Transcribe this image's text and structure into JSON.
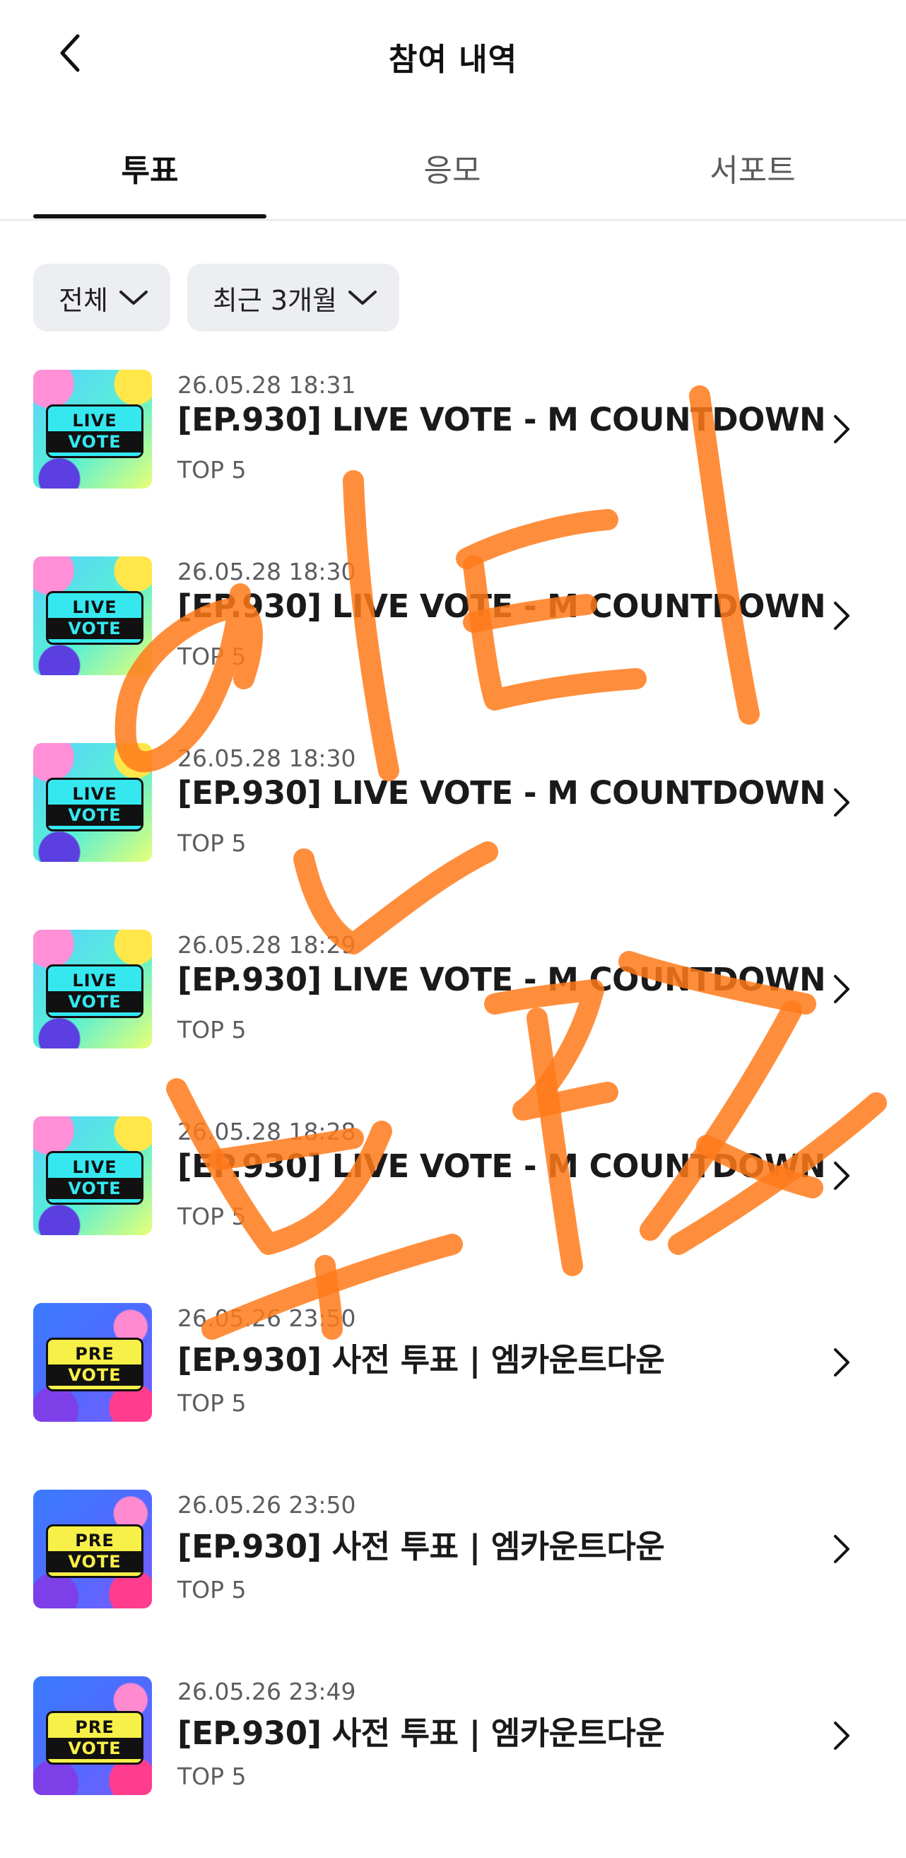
{
  "header": {
    "title": "참여 내역"
  },
  "tabs": [
    {
      "label": "투표",
      "active": true
    },
    {
      "label": "응모",
      "active": false
    },
    {
      "label": "서포트",
      "active": false
    }
  ],
  "filters": [
    {
      "label": "전체"
    },
    {
      "label": "최근 3개월"
    }
  ],
  "items": [
    {
      "date": "26.05.28 18:31",
      "title": "[EP.930] LIVE VOTE - M COUNTDOWN",
      "sub": "TOP 5",
      "thumb": {
        "line1": "LIVE",
        "line2": "VOTE"
      }
    },
    {
      "date": "26.05.28 18:30",
      "title": "[EP.930] LIVE VOTE - M COUNTDOWN",
      "sub": "TOP 5",
      "thumb": {
        "line1": "LIVE",
        "line2": "VOTE"
      }
    },
    {
      "date": "26.05.28 18:30",
      "title": "[EP.930] LIVE VOTE - M COUNTDOWN",
      "sub": "TOP 5",
      "thumb": {
        "line1": "LIVE",
        "line2": "VOTE"
      }
    },
    {
      "date": "26.05.28 18:29",
      "title": "[EP.930] LIVE VOTE - M COUNTDOWN",
      "sub": "TOP 5",
      "thumb": {
        "line1": "LIVE",
        "line2": "VOTE"
      }
    },
    {
      "date": "26.05.28 18:28",
      "title": "[EP.930] LIVE VOTE - M COUNTDOWN",
      "sub": "TOP 5",
      "thumb": {
        "line1": "LIVE",
        "line2": "VOTE"
      }
    },
    {
      "date": "26.05.26 23:50",
      "title": "[EP.930] 사전 투표 | 엠카운트다운",
      "sub": "TOP 5",
      "thumb": {
        "line1": "PRE",
        "line2": "VOTE"
      }
    },
    {
      "date": "26.05.26 23:50",
      "title": "[EP.930] 사전 투표 | 엠카운트다운",
      "sub": "TOP 5",
      "thumb": {
        "line1": "PRE",
        "line2": "VOTE"
      }
    },
    {
      "date": "26.05.26 23:49",
      "title": "[EP.930] 사전 투표 | 엠카운트다운",
      "sub": "TOP 5",
      "thumb": {
        "line1": "PRE",
        "line2": "VOTE"
      }
    }
  ],
  "overlay": {
    "color": "#ff7a1a",
    "description_text": "미티 ✓ 브리즈"
  }
}
